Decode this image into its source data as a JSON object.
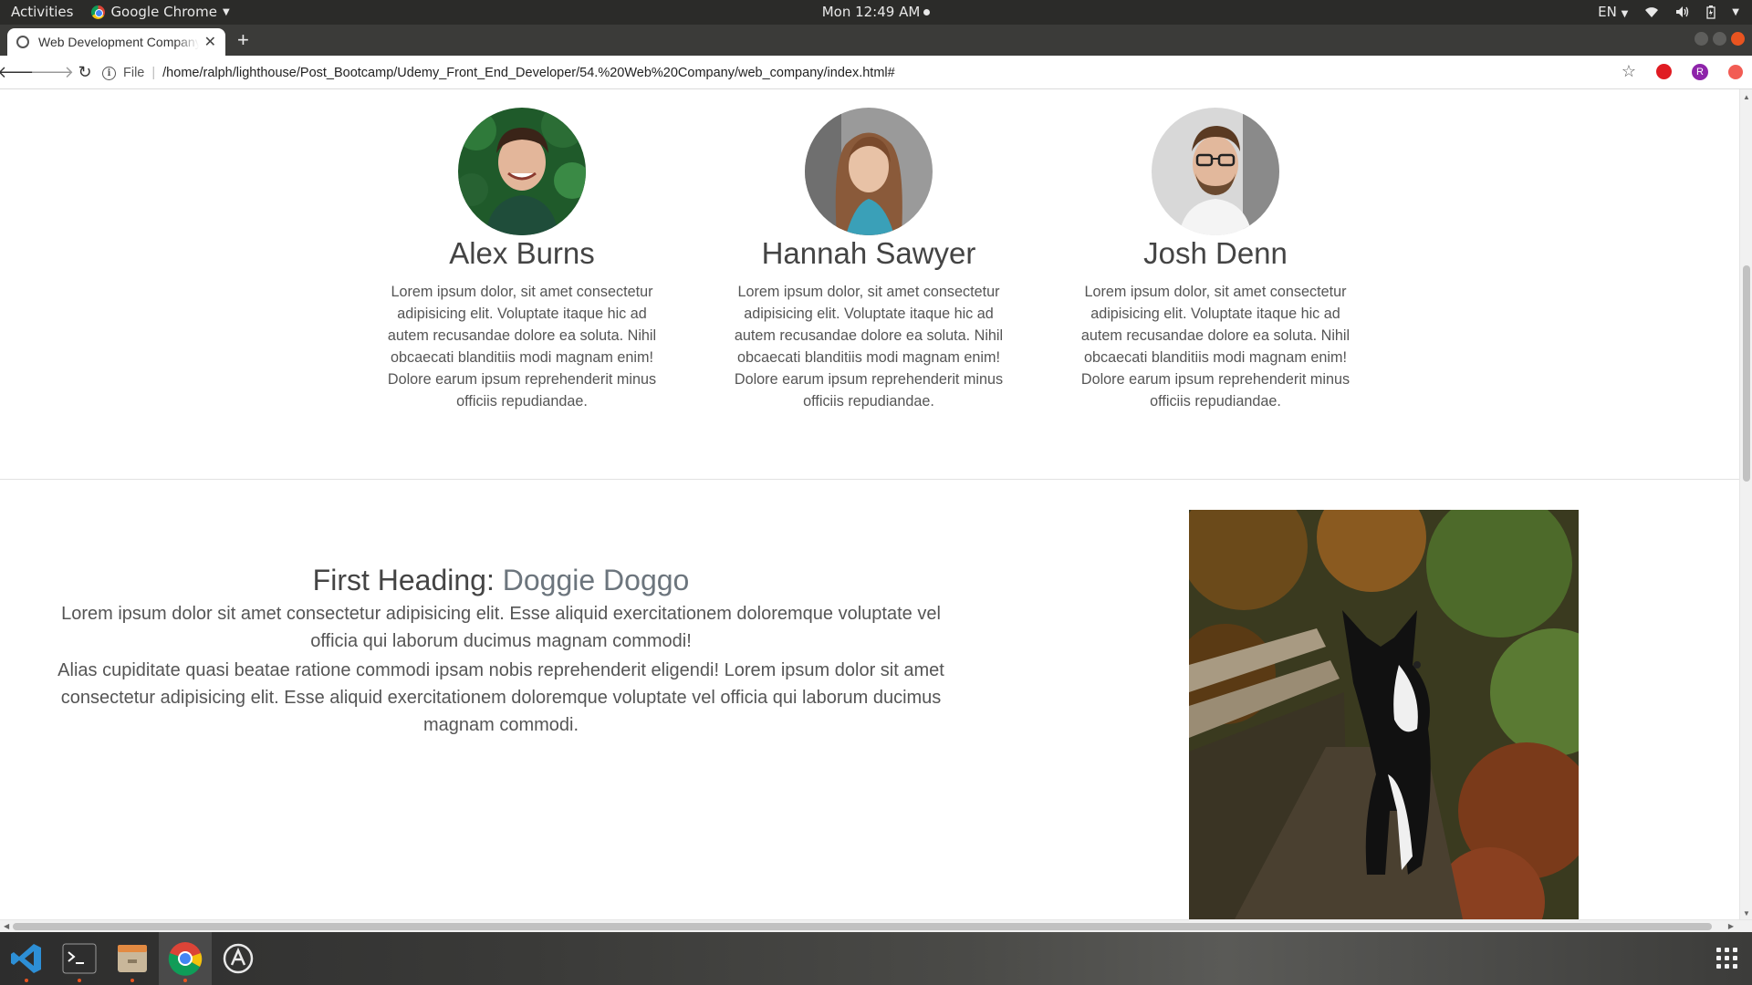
{
  "system_bar": {
    "activities": "Activities",
    "app_name": "Google Chrome",
    "clock": "Mon 12:49 AM",
    "language": "EN"
  },
  "browser": {
    "tab_title": "Web Development Company",
    "address_scheme": "File",
    "url": "/home/ralph/lighthouse/Post_Bootcamp/Udemy_Front_End_Developer/54.%20Web%20Company/web_company/index.html#",
    "profile_initial": "R"
  },
  "team": {
    "members": [
      {
        "name": "Alex Burns",
        "bio": "Lorem ipsum dolor, sit amet consectetur adipisicing elit. Voluptate itaque hic ad autem recusandae dolore ea soluta. Nihil obcaecati blanditiis modi magnam enim! Dolore earum ipsum reprehenderit minus officiis repudiandae."
      },
      {
        "name": "Hannah Sawyer",
        "bio": "Lorem ipsum dolor, sit amet consectetur adipisicing elit. Voluptate itaque hic ad autem recusandae dolore ea soluta. Nihil obcaecati blanditiis modi magnam enim! Dolore earum ipsum reprehenderit minus officiis repudiandae."
      },
      {
        "name": "Josh Denn",
        "bio": "Lorem ipsum dolor, sit amet consectetur adipisicing elit. Voluptate itaque hic ad autem recusandae dolore ea soluta. Nihil obcaecati blanditiis modi magnam enim! Dolore earum ipsum reprehenderit minus officiis repudiandae."
      }
    ]
  },
  "feature": {
    "heading_main": "First Heading:",
    "heading_muted": "Doggie Doggo",
    "paragraph_1": "Lorem ipsum dolor sit amet consectetur adipisicing elit. Esse aliquid exercitationem doloremque voluptate vel officia qui laborum ducimus magnam commodi!",
    "paragraph_2": "Alias cupiditate quasi beatae ratione commodi ipsam nobis reprehenderit eligendi! Lorem ipsum dolor sit amet consectetur adipisicing elit. Esse aliquid exercitationem doloremque voluptate vel officia qui laborum ducimus magnam commodi."
  },
  "dock": {
    "apps": [
      "vscode-icon",
      "terminal-icon",
      "files-icon",
      "chrome-icon",
      "software-updater-icon"
    ]
  },
  "colors": {
    "ubuntu_orange": "#e95420",
    "heading_text": "#444444",
    "muted_heading": "#6c757d"
  }
}
